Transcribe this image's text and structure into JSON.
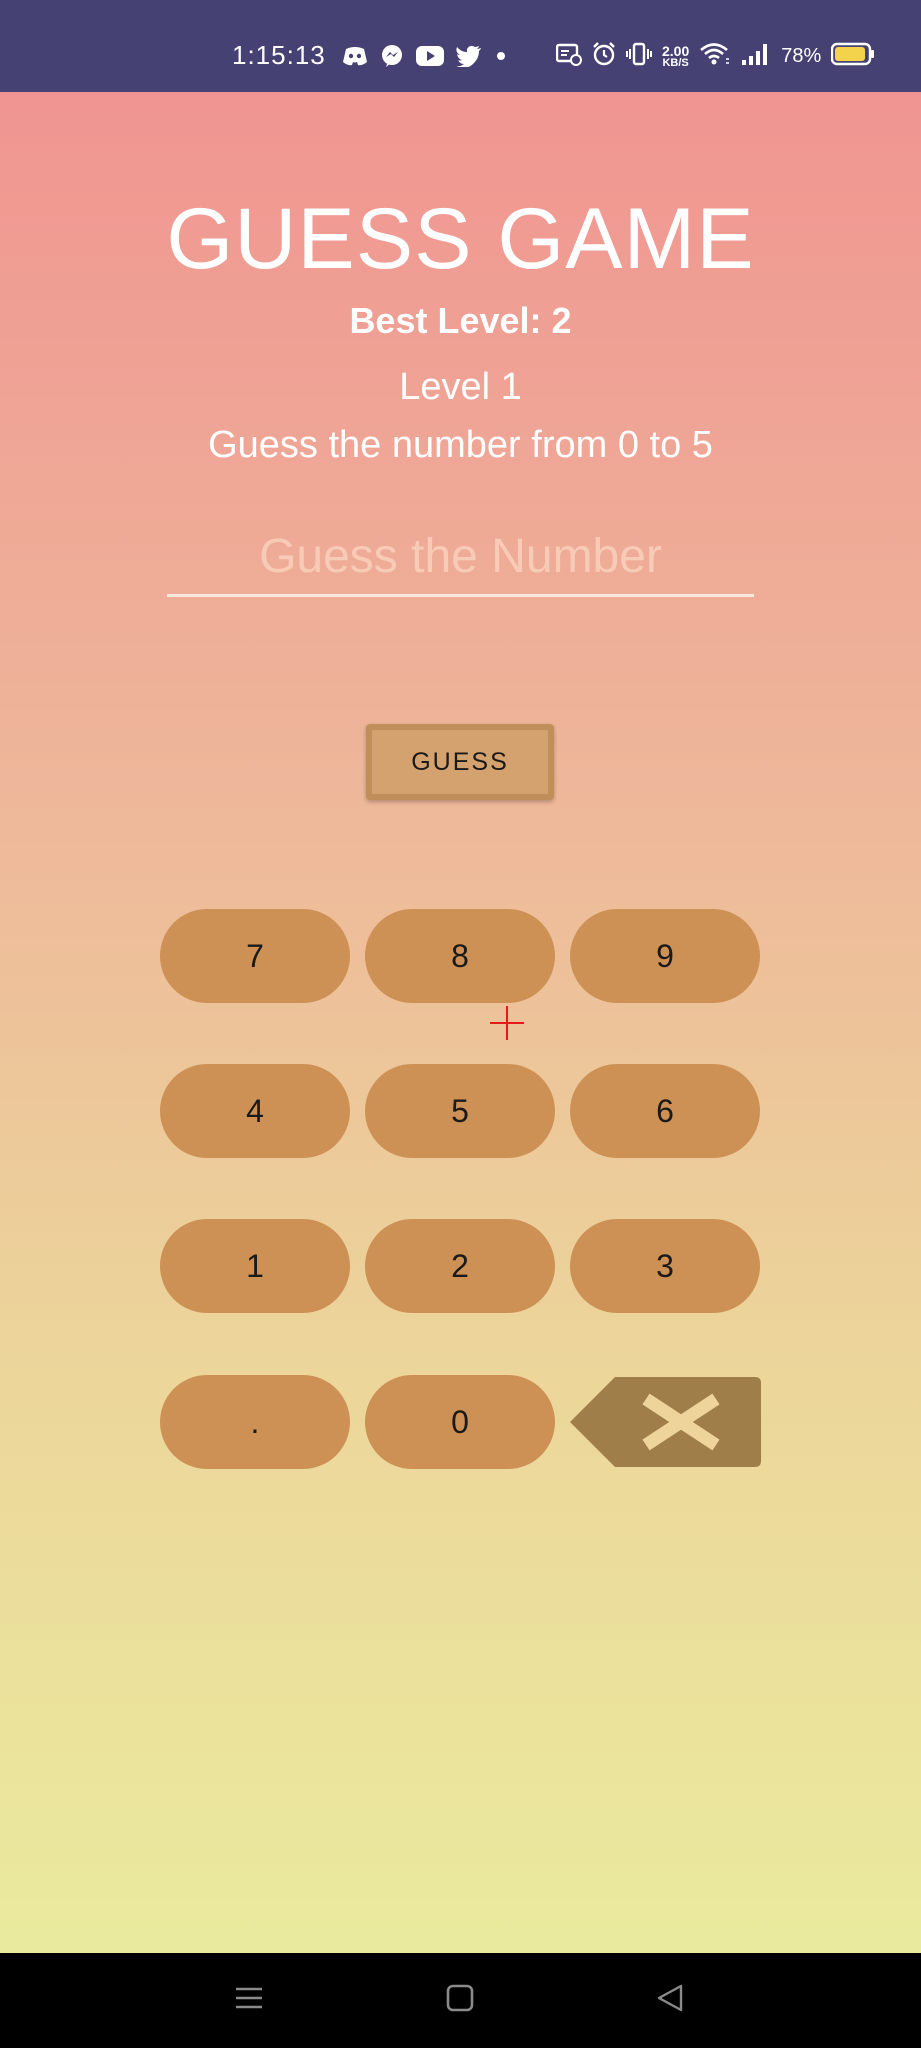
{
  "status_bar": {
    "time": "1:15:13",
    "net_speed_value": "2.00",
    "net_speed_unit": "KB/S",
    "battery": "78%",
    "icons_left": [
      "discord-icon",
      "messenger-icon",
      "youtube-icon",
      "twitter-icon",
      "dot-icon"
    ],
    "icons_right": [
      "screen-cast-icon",
      "alarm-icon",
      "vibrate-icon",
      "wifi-icon",
      "signal-icon",
      "battery-icon"
    ]
  },
  "game": {
    "title": "GUESS GAME",
    "best_level": "Best Level: 2",
    "level": "Level 1",
    "hint": "Guess the number from 0 to 5",
    "input_placeholder": "Guess the Number",
    "input_value": "",
    "guess_button": "GUESS"
  },
  "keypad": {
    "keys": [
      "7",
      "8",
      "9",
      "4",
      "5",
      "6",
      "1",
      "2",
      "3",
      ".",
      "0"
    ],
    "backspace_icon": "backspace-icon"
  },
  "navigation": {
    "buttons": [
      "menu-icon",
      "home-icon",
      "back-icon"
    ]
  },
  "colors": {
    "status_bar": "#454273",
    "key": "#cd9055",
    "guess_button": "#d4a26e",
    "backspace": "#a07e4a",
    "backspace_x": "#eed39a"
  }
}
